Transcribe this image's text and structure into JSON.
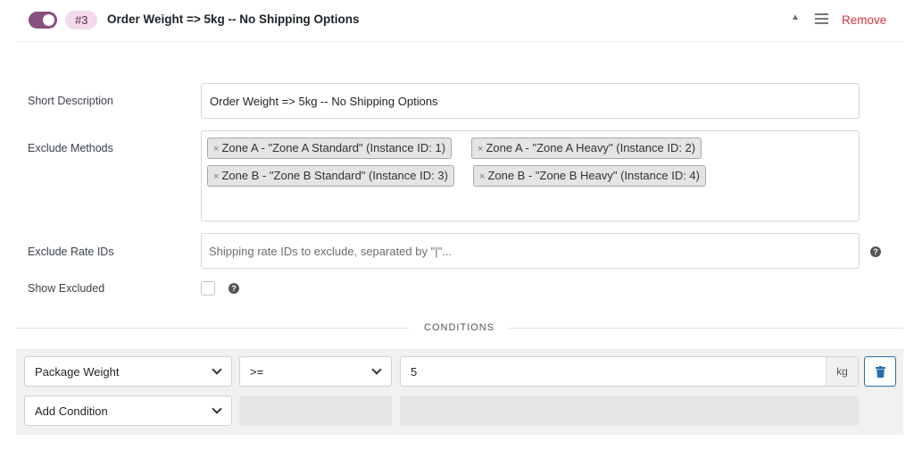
{
  "header": {
    "rule_number": "#3",
    "title": "Order Weight => 5kg -- No Shipping Options",
    "remove_label": "Remove",
    "enabled": true
  },
  "form": {
    "short_description": {
      "label": "Short Description",
      "value": "Order Weight => 5kg -- No Shipping Options"
    },
    "exclude_methods": {
      "label": "Exclude Methods",
      "chips": [
        "Zone A - \"Zone A Standard\" (Instance ID: 1)",
        "Zone A - \"Zone A Heavy\" (Instance ID: 2)",
        "Zone B - \"Zone B Standard\" (Instance ID: 3)",
        "Zone B - \"Zone B Heavy\" (Instance ID: 4)"
      ]
    },
    "exclude_rate_ids": {
      "label": "Exclude Rate IDs",
      "placeholder": "Shipping rate IDs to exclude, separated by \"|\"..."
    },
    "show_excluded": {
      "label": "Show Excluded",
      "checked": false
    }
  },
  "conditions": {
    "title": "CONDITIONS",
    "rows": [
      {
        "field": "Package Weight",
        "operator": ">=",
        "value": "5",
        "unit": "kg"
      }
    ],
    "add_condition_label": "Add Condition"
  },
  "colors": {
    "toggle": "#8a4f7d",
    "badge_bg": "#f3dbeb",
    "remove": "#d63638",
    "delete_button": "#2271b1"
  }
}
